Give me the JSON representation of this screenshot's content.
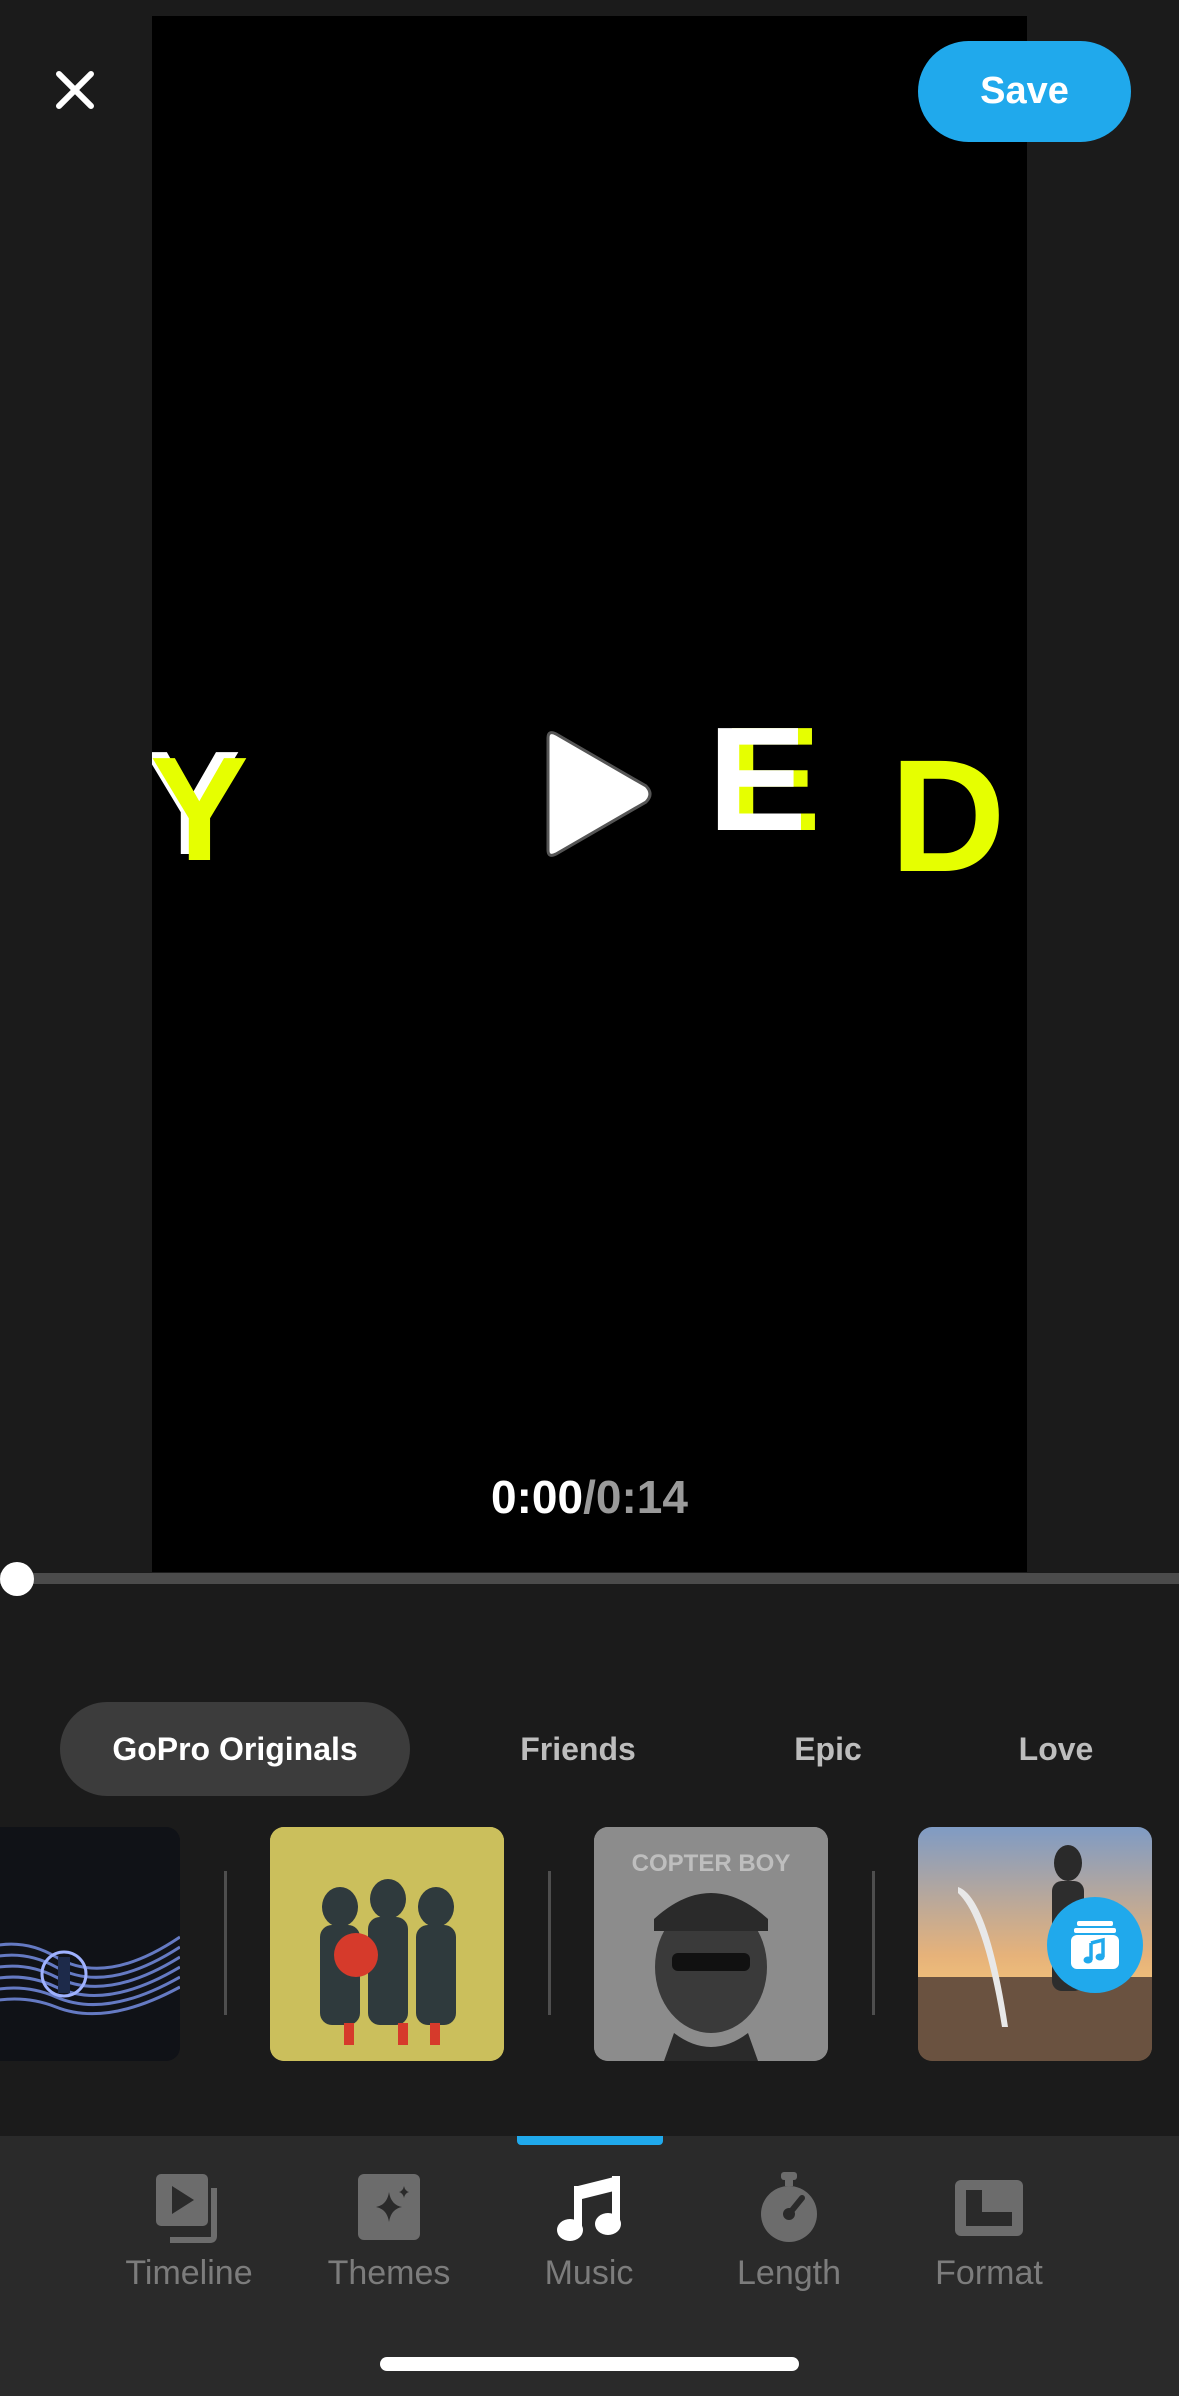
{
  "header": {
    "save_label": "Save"
  },
  "preview": {
    "letters": [
      "Y",
      "E",
      "D"
    ],
    "time_current": "0:00",
    "time_separator": "/",
    "time_total": "0:14",
    "playhead_fraction": 0
  },
  "categories": [
    {
      "label": "GoPro Originals",
      "active": true
    },
    {
      "label": "Friends",
      "active": false
    },
    {
      "label": "Epic",
      "active": false
    },
    {
      "label": "Love",
      "active": false
    }
  ],
  "tracks": [
    {
      "art": "light-waves",
      "art_text": ""
    },
    {
      "art": "three-figures",
      "art_text": ""
    },
    {
      "art": "portrait",
      "art_text": "COPTER BOY"
    },
    {
      "art": "harp-sunset",
      "art_text": ""
    }
  ],
  "tabs": [
    {
      "label": "Timeline",
      "icon": "timeline-icon",
      "active": false
    },
    {
      "label": "Themes",
      "icon": "themes-icon",
      "active": false
    },
    {
      "label": "Music",
      "icon": "music-note-icon",
      "active": true
    },
    {
      "label": "Length",
      "icon": "stopwatch-icon",
      "active": false
    },
    {
      "label": "Format",
      "icon": "format-icon",
      "active": false
    }
  ],
  "colors": {
    "accent": "#20a9ec",
    "title_yellow": "#e6ff00",
    "background": "#1b1b1b",
    "tab_bar": "#2a2a2a"
  }
}
